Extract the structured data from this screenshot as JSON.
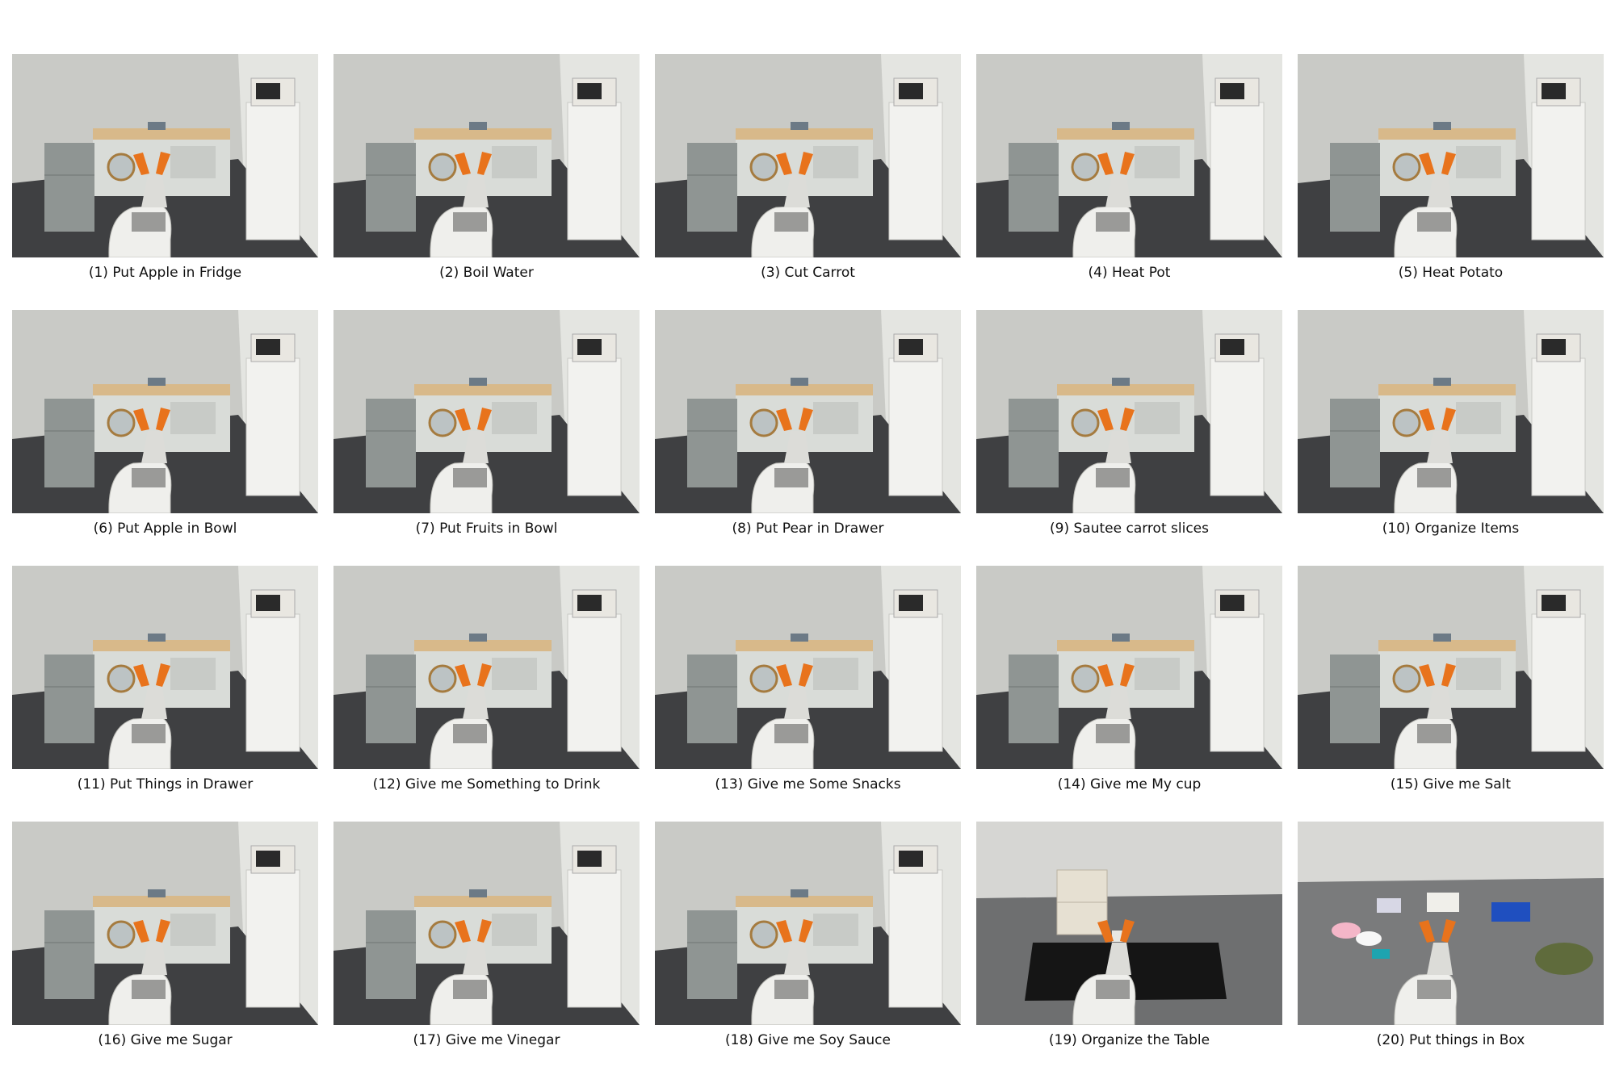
{
  "panels": [
    {
      "caption": "(1) Put Apple in Fridge",
      "scene": "kitchen"
    },
    {
      "caption": "(2) Boil Water",
      "scene": "kitchen"
    },
    {
      "caption": "(3) Cut Carrot",
      "scene": "kitchen"
    },
    {
      "caption": "(4) Heat Pot",
      "scene": "kitchen"
    },
    {
      "caption": "(5) Heat Potato",
      "scene": "kitchen"
    },
    {
      "caption": "(6) Put Apple in Bowl",
      "scene": "kitchen"
    },
    {
      "caption": "(7) Put Fruits in Bowl",
      "scene": "kitchen"
    },
    {
      "caption": "(8) Put Pear in Drawer",
      "scene": "kitchen"
    },
    {
      "caption": "(9) Sautee carrot slices",
      "scene": "kitchen"
    },
    {
      "caption": "(10) Organize Items",
      "scene": "kitchen"
    },
    {
      "caption": "(11) Put Things in Drawer",
      "scene": "kitchen"
    },
    {
      "caption": "(12) Give me Something to Drink",
      "scene": "kitchen"
    },
    {
      "caption": "(13) Give me Some Snacks",
      "scene": "kitchen"
    },
    {
      "caption": "(14) Give me My cup",
      "scene": "kitchen"
    },
    {
      "caption": "(15) Give me Salt",
      "scene": "kitchen"
    },
    {
      "caption": "(16) Give me Sugar",
      "scene": "kitchen"
    },
    {
      "caption": "(17) Give me Vinegar",
      "scene": "kitchen"
    },
    {
      "caption": "(18) Give me Soy Sauce",
      "scene": "kitchen"
    },
    {
      "caption": "(19) Organize the Table",
      "scene": "table"
    },
    {
      "caption": "(20) Put things in Box",
      "scene": "floor"
    }
  ],
  "colors": {
    "wall": "#c9cac6",
    "wall_side": "#e4e5e1",
    "floor": "#3f4042",
    "counter": "#d8b98a",
    "cabinet": "#d9dcd8",
    "fridge": "#8f9593",
    "robot_white": "#efefec",
    "gripper_orange": "#e8731c",
    "table_black": "#151515"
  }
}
